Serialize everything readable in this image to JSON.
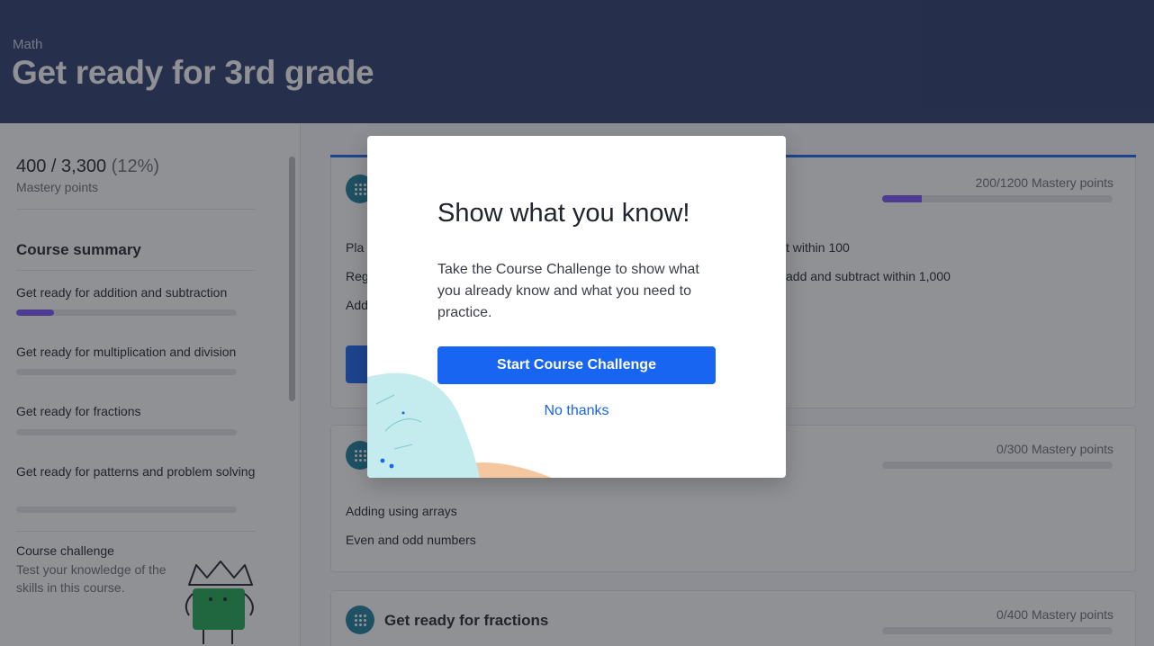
{
  "header": {
    "subject": "Math",
    "title": "Get ready for 3rd grade",
    "background_color": "#2a3a6a"
  },
  "sidebar": {
    "mastery_total": "400 / 3,300",
    "mastery_percent": "(12%)",
    "mastery_label": "Mastery points",
    "course_summary_heading": "Course summary",
    "units": [
      {
        "label": "Get ready for addition and subtraction",
        "progress": 0.17
      },
      {
        "label": "Get ready for multiplication and division",
        "progress": 0
      },
      {
        "label": "Get ready for fractions",
        "progress": 0
      },
      {
        "label": "Get ready for patterns and problem solving",
        "progress": 0
      }
    ],
    "course_challenge": {
      "title": "Course challenge",
      "description": "Test your knowledge of the skills in this course."
    }
  },
  "main": {
    "cards": [
      {
        "mastery_points": "200/1200 Mastery points",
        "progress": 0.17,
        "lessons_left": [
          "Pla",
          "Reg",
          "Add"
        ],
        "lessons_right": [
          "t within 100",
          "add and subtract within 1,000"
        ]
      },
      {
        "mastery_points": "0/300 Mastery points",
        "progress": 0,
        "lessons": [
          "Adding using arrays",
          "Even and odd numbers"
        ]
      },
      {
        "title": "Get ready for fractions",
        "mastery_points": "0/400 Mastery points",
        "progress": 0
      }
    ]
  },
  "modal": {
    "title": "Show what you know!",
    "body": "Take the Course Challenge to show what you already know and what you need to practice.",
    "primary_button": "Start Course Challenge",
    "secondary_link": "No thanks"
  },
  "colors": {
    "accent_blue": "#1865f2",
    "mastery_purple": "#7854f7"
  }
}
